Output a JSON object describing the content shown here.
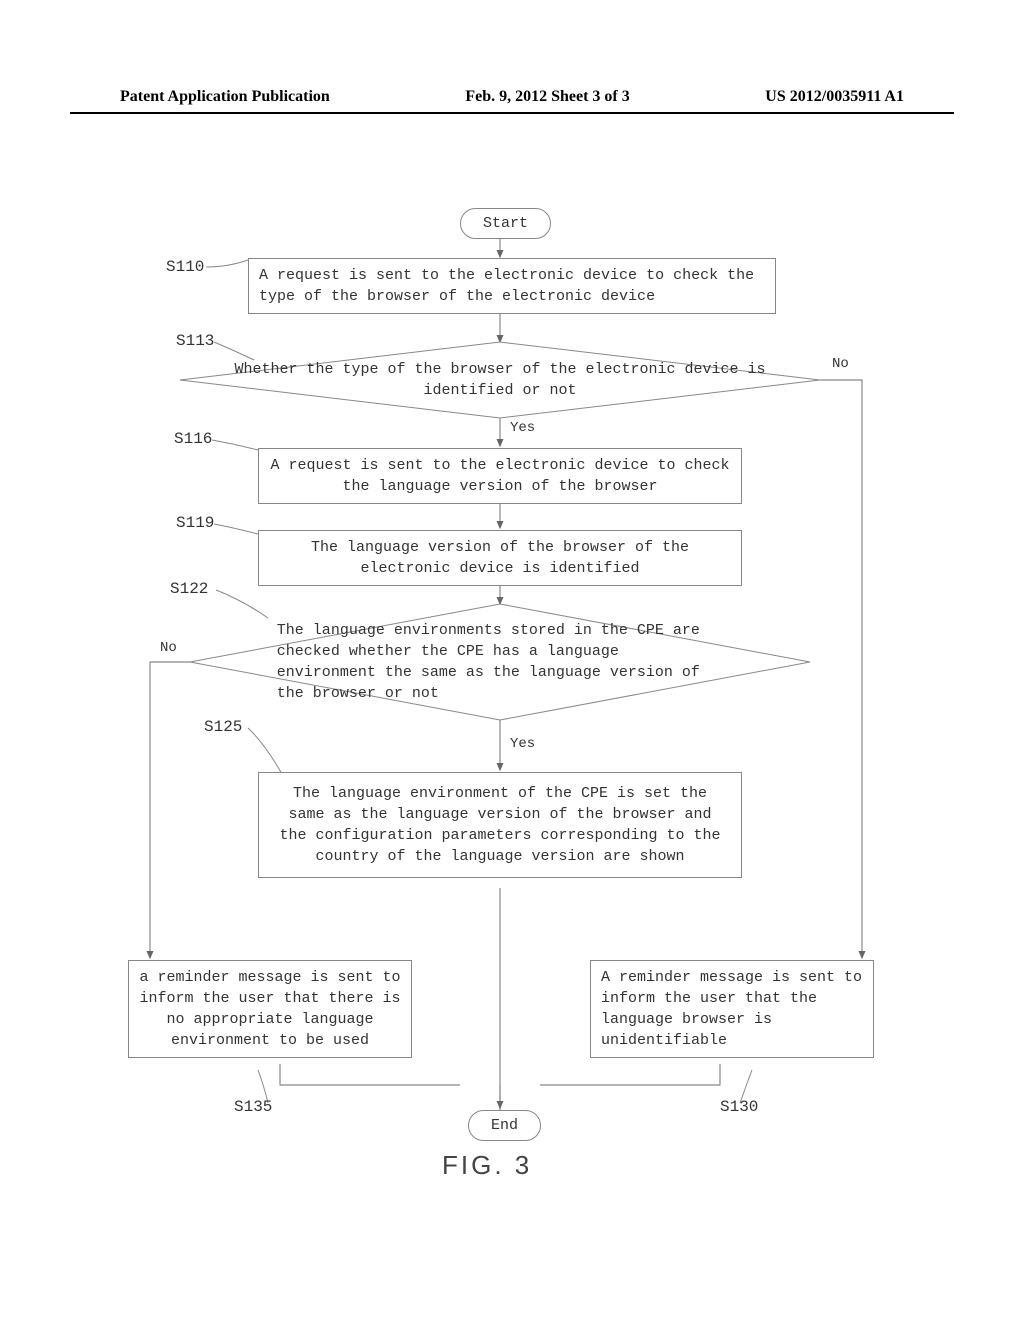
{
  "header": {
    "left": "Patent Application Publication",
    "center": "Feb. 9, 2012   Sheet 3 of 3",
    "right": "US 2012/0035911 A1"
  },
  "nodes": {
    "start": "Start",
    "s110": "A request is sent to the electronic device to check the type of the browser of the electronic device",
    "s113": "Whether the type of the browser of the electronic device is identified or not",
    "s116": "A request is sent to the electronic device to check the language version of the browser",
    "s119": "The language version of the browser of the electronic device is identified",
    "s122": "The language environments stored in the CPE are checked whether the CPE has a language environment the same as the language version of the browser or not",
    "s125": "The language environment of the CPE is set the same as the language version of the browser and the configuration parameters corresponding to the country of the language version are shown",
    "s135": "a reminder message is sent to inform the user that there is no appropriate language environment to be used",
    "s130": "A reminder message is sent to inform the user that the language browser is unidentifiable",
    "end": "End"
  },
  "labels": {
    "yes": "Yes",
    "no": "No",
    "s110": "S110",
    "s113": "S113",
    "s116": "S116",
    "s119": "S119",
    "s122": "S122",
    "s125": "S125",
    "s130": "S130",
    "s135": "S135"
  },
  "figure": "FIG. 3"
}
